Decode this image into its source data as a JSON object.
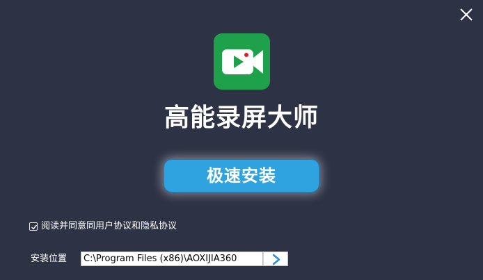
{
  "window": {
    "close_icon": "close-icon"
  },
  "app": {
    "logo_icon": "video-camera-icon",
    "title": "高能录屏大师"
  },
  "install_button": {
    "label": "极速安装"
  },
  "agreement": {
    "checked": true,
    "label": "阅读并同意同用户协议和隐私协议"
  },
  "install_path": {
    "label": "安装位置",
    "value": "C:\\Program Files (x86)\\AOXIJIA360",
    "browse_icon": "chevron-right-icon"
  },
  "colors": {
    "background": "#2d3244",
    "logo_green": "#1fa14b",
    "button_blue": "#2fa3e0",
    "record_dot": "#e02020",
    "arrow_blue": "#2c8fd6"
  }
}
